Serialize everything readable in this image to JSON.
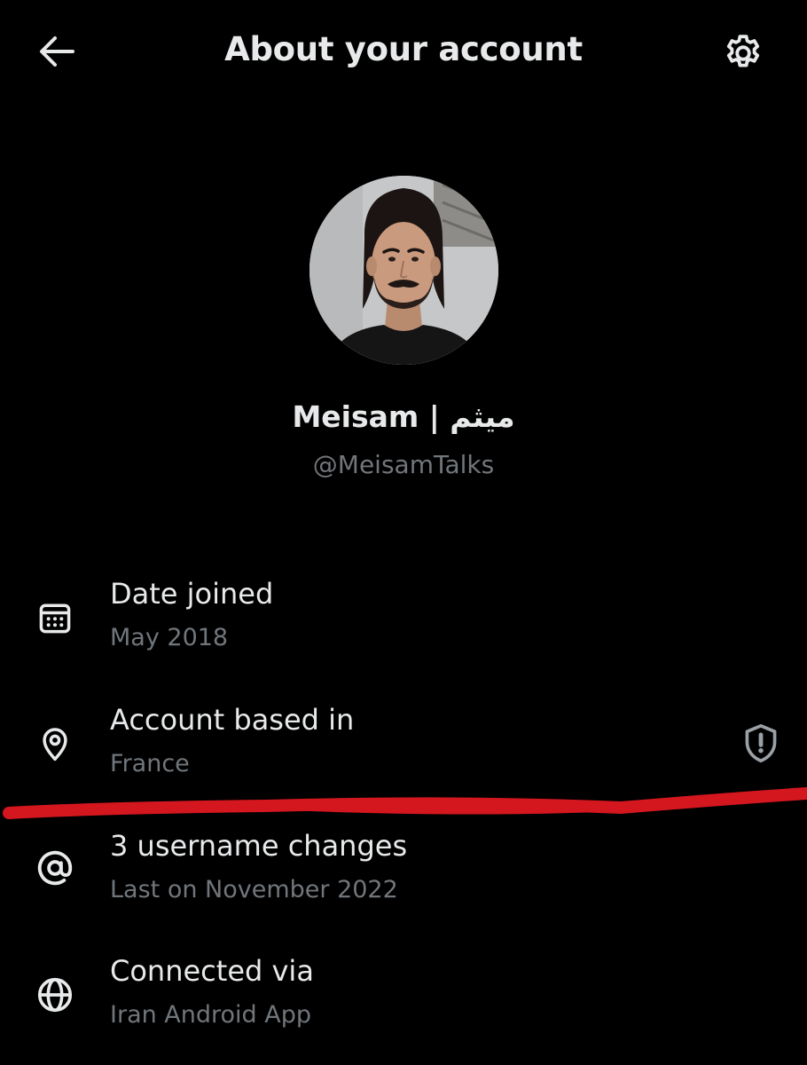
{
  "header": {
    "back_icon": "arrow-left-icon",
    "title": "About your account",
    "settings_icon": "gear-icon"
  },
  "profile": {
    "display_name": "Meisam | میثم",
    "handle": "@MeisamTalks"
  },
  "items": [
    {
      "icon": "calendar-icon",
      "label": "Date joined",
      "value": "May 2018"
    },
    {
      "icon": "location-pin-icon",
      "label": "Account based in",
      "value": "France"
    },
    {
      "icon": "at-sign-icon",
      "label": "3 username changes",
      "value": "Last on November 2022"
    },
    {
      "icon": "globe-icon",
      "label": "Connected via",
      "value": "Iran Android App"
    }
  ],
  "colors": {
    "background": "#000000",
    "primary_text": "#e7e9ea",
    "secondary_text": "#71767b",
    "annotation": "#d4161e"
  }
}
